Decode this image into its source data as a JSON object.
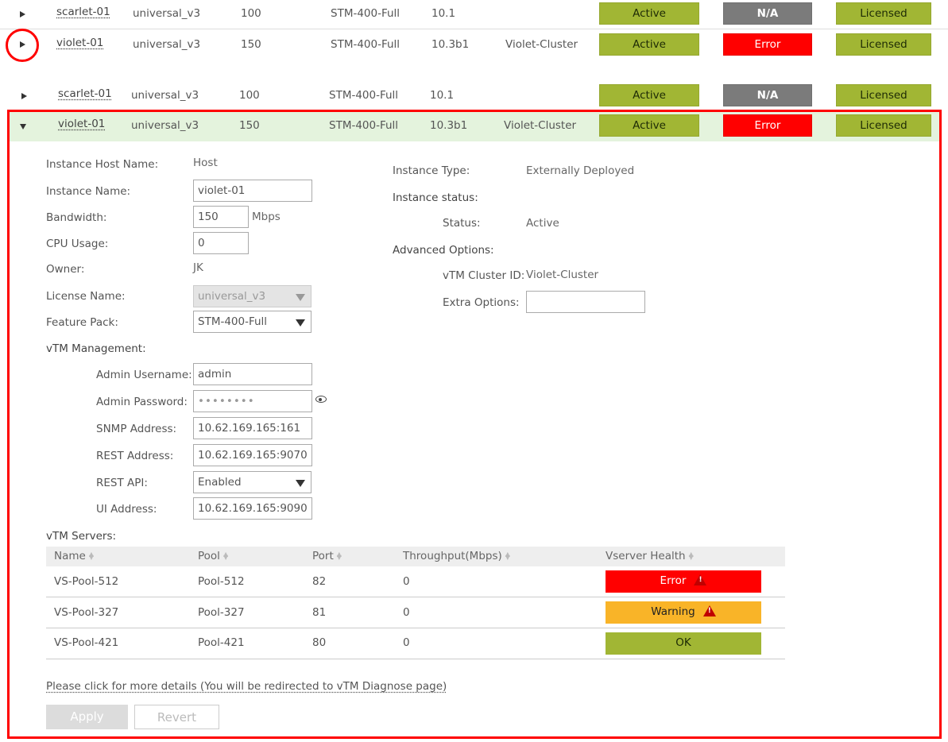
{
  "rows": [
    {
      "name": "scarlet-01",
      "license": "universal_v3",
      "bandwidth": "100",
      "feature_pack": "STM-400-Full",
      "version": "10.1",
      "cluster": "",
      "status": "Active",
      "health": "N/A",
      "licensed": "Licensed"
    },
    {
      "name": "violet-01",
      "license": "universal_v3",
      "bandwidth": "150",
      "feature_pack": "STM-400-Full",
      "version": "10.3b1",
      "cluster": "Violet-Cluster",
      "status": "Active",
      "health": "Error",
      "licensed": "Licensed"
    },
    {
      "name": "scarlet-01",
      "license": "universal_v3",
      "bandwidth": "100",
      "feature_pack": "STM-400-Full",
      "version": "10.1",
      "cluster": "",
      "status": "Active",
      "health": "N/A",
      "licensed": "Licensed"
    },
    {
      "name": "violet-01",
      "license": "universal_v3",
      "bandwidth": "150",
      "feature_pack": "STM-400-Full",
      "version": "10.3b1",
      "cluster": "Violet-Cluster",
      "status": "Active",
      "health": "Error",
      "licensed": "Licensed"
    }
  ],
  "details": {
    "host_name_label": "Instance Host Name:",
    "host_name": "Host",
    "instance_name_label": "Instance Name:",
    "instance_name": "violet-01",
    "bandwidth_label": "Bandwidth:",
    "bandwidth": "150",
    "bandwidth_unit": "Mbps",
    "cpu_label": "CPU Usage:",
    "cpu": "0",
    "owner_label": "Owner:",
    "owner": "JK",
    "license_label": "License Name:",
    "license": "universal_v3",
    "feature_label": "Feature Pack:",
    "feature": "STM-400-Full",
    "type_label": "Instance Type:",
    "type": "Externally Deployed",
    "status_heading": "Instance status:",
    "status_label": "Status:",
    "status": "Active",
    "advanced_heading": "Advanced Options:",
    "cluster_label": "vTM Cluster ID:",
    "cluster": "Violet-Cluster",
    "extra_label": "Extra Options:",
    "extra": ""
  },
  "management": {
    "heading": "vTM Management:",
    "admin_user_label": "Admin Username:",
    "admin_user": "admin",
    "admin_pass_label": "Admin Password:",
    "admin_pass": "••••••••",
    "snmp_label": "SNMP Address:",
    "snmp": "10.62.169.165:161",
    "rest_label": "REST Address:",
    "rest": "10.62.169.165:9070",
    "rest_api_label": "REST API:",
    "rest_api": "Enabled",
    "ui_label": "UI Address:",
    "ui": "10.62.169.165:9090"
  },
  "servers": {
    "heading": "vTM Servers:",
    "columns": [
      "Name",
      "Pool",
      "Port",
      "Throughput(Mbps)",
      "Vserver Health"
    ],
    "rows": [
      {
        "name": "VS-Pool-512",
        "pool": "Pool-512",
        "port": "82",
        "throughput": "0",
        "health": "Error"
      },
      {
        "name": "VS-Pool-327",
        "pool": "Pool-327",
        "port": "81",
        "throughput": "0",
        "health": "Warning"
      },
      {
        "name": "VS-Pool-421",
        "pool": "Pool-421",
        "port": "80",
        "throughput": "0",
        "health": "OK"
      }
    ]
  },
  "footer": {
    "details_link": "Please click for more details (You will be redirected to vTM Diagnose page)",
    "apply": "Apply",
    "revert": "Revert"
  },
  "colors": {
    "active": "#a1b634",
    "error": "#ff0000",
    "na": "#7b7b7b",
    "warning": "#f9b428",
    "highlight": "#ff0000"
  }
}
